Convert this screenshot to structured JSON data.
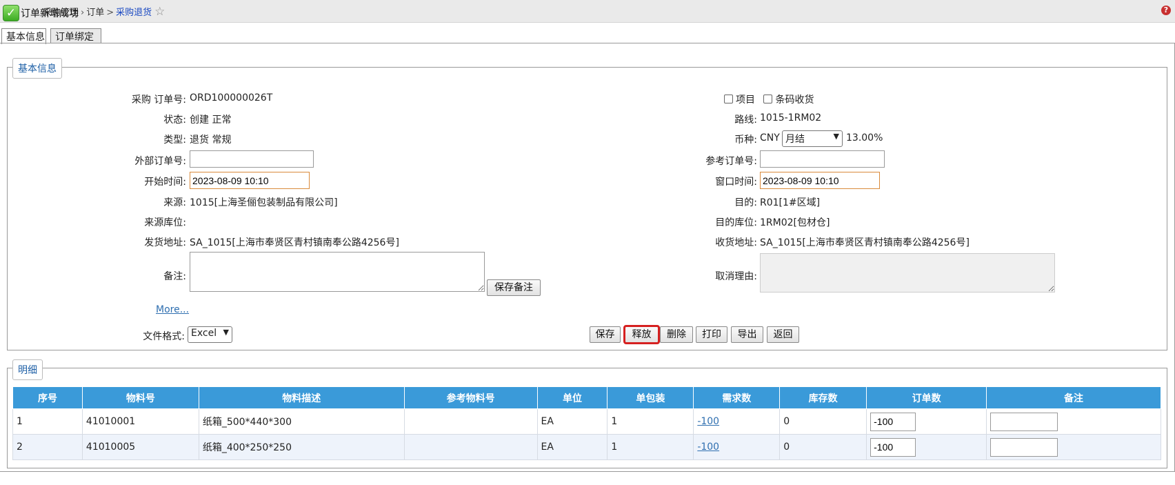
{
  "toast": {
    "icon": "check-icon",
    "message": "订单新增成功"
  },
  "breadcrumb": {
    "items": [
      "采购管理",
      "订单"
    ],
    "current": "采购退货"
  },
  "help_icon": "?",
  "tabs": [
    "基本信息",
    "订单绑定"
  ],
  "basic": {
    "legend": "基本信息",
    "order_no_label": "采购 订单号:",
    "order_no": "ORD100000026T",
    "status_label": "状态:",
    "status": "创建 正常",
    "type_label": "类型:",
    "type": "退货 常规",
    "external_no_label": "外部订单号:",
    "external_no": "",
    "start_time_label": "开始时间:",
    "start_time": "2023-08-09 10:10",
    "source_label": "来源:",
    "source": "1015[上海圣俪包装制品有限公司]",
    "source_loc_label": "来源库位:",
    "source_loc": "",
    "ship_addr_label": "发货地址:",
    "ship_addr": "SA_1015[上海市奉贤区青村镇南奉公路4256号]",
    "remark_label": "备注:",
    "remark": "",
    "save_remark": "保存备注",
    "more": "More...",
    "file_format_label": "文件格式:",
    "file_format": "Excel",
    "project_label": "项目",
    "barcode_label": "条码收货",
    "route_label": "路线:",
    "route": "1015-1RM02",
    "currency_label": "币种:",
    "currency": "CNY",
    "settlement": "月结",
    "tax_rate": "13.00%",
    "ref_no_label": "参考订单号:",
    "ref_no": "",
    "window_time_label": "窗口时间:",
    "window_time": "2023-08-09 10:10",
    "dest_label": "目的:",
    "dest": "R01[1#区域]",
    "dest_loc_label": "目的库位:",
    "dest_loc": "1RM02[包材仓]",
    "recv_addr_label": "收货地址:",
    "recv_addr": "SA_1015[上海市奉贤区青村镇南奉公路4256号]",
    "cancel_reason_label": "取消理由:",
    "actions": [
      "保存",
      "释放",
      "删除",
      "打印",
      "导出",
      "返回"
    ]
  },
  "detail": {
    "legend": "明细",
    "columns": [
      "序号",
      "物料号",
      "物料描述",
      "参考物料号",
      "单位",
      "单包装",
      "需求数",
      "库存数",
      "订单数",
      "备注"
    ],
    "rows": [
      {
        "seq": "1",
        "material": "41010001",
        "desc": "纸箱_500*440*300",
        "ref": "",
        "unit": "EA",
        "pack": "1",
        "demand": "-100",
        "stock": "0",
        "qty": "-100",
        "remark": ""
      },
      {
        "seq": "2",
        "material": "41010005",
        "desc": "纸箱_400*250*250",
        "ref": "",
        "unit": "EA",
        "pack": "1",
        "demand": "-100",
        "stock": "0",
        "qty": "-100",
        "remark": ""
      }
    ]
  }
}
